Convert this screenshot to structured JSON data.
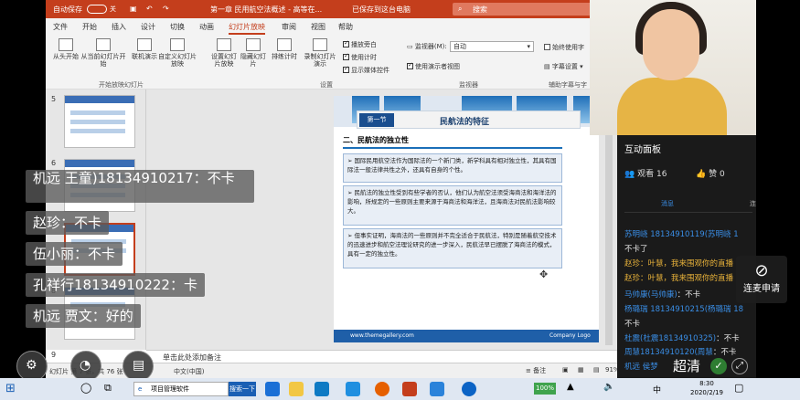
{
  "ppt": {
    "titlebar": {
      "autosave_label": "自动保存",
      "autosave_state": "关",
      "doc_title": "第一章 民用航空法概述 - 高等在...",
      "saved_status": "已保存到这台电脑",
      "search_placeholder": "搜索"
    },
    "tabs": [
      "文件",
      "开始",
      "插入",
      "设计",
      "切换",
      "动画",
      "幻灯片放映",
      "审阅",
      "视图",
      "帮助"
    ],
    "active_tab": "幻灯片放映",
    "ribbon": {
      "btn_from_start": "从头开始",
      "btn_from_current": "从当前幻灯片开始",
      "btn_online": "联机演示",
      "btn_custom": "自定义幻灯片放映",
      "group_start": "开始放映幻灯片",
      "btn_setup": "设置幻灯片放映",
      "btn_hide": "隐藏幻灯片",
      "btn_rehearse": "排练计时",
      "btn_record": "录制幻灯片演示",
      "chk_narration": "播放旁白",
      "chk_timing": "使用计时",
      "chk_media": "显示媒体控件",
      "group_setup": "设置",
      "monitor_label": "监视器(M):",
      "monitor_value": "自动",
      "chk_presenter": "使用演示者视图",
      "group_monitor": "监视器",
      "chk_subtitles": "始终使用字",
      "subtitle_setting": "字幕设置",
      "group_caption": "辅助字幕与字"
    },
    "thumbs": {
      "n5": "5",
      "n6": "6",
      "n7": "7",
      "n8": "8",
      "n9": "9"
    },
    "slide": {
      "section_label": "第一节",
      "section_title": "民航法的特征",
      "subheading": "二、民航法的独立性",
      "paragraphs": [
        "➢ 国际民用航空法作为国际法的一个新门类，新学科具有相对独立性，其具有国际法一般法律共性之外，还具有自身的个性。",
        "➢ 民航法的独立性受到有些学者的否认，他们认为航空法须受海商法和海洋法的影响，所规定的一些原则主要来源于海商法和海洋法，且海商法对民航法影响较大。",
        "➢ 但事实证明，海商法的一些原则并不完全适合于民航法，特别是随着航空技术的迅速进步和航空法理论研究的进一步深入，民航法早已摆脱了海商法的模式，具有一定的独立性。"
      ],
      "footer_url": "www.themegallery.com",
      "footer_logo": "Company Logo"
    },
    "notes_placeholder": "单击此处添加备注",
    "status": {
      "slide_pos": "幻灯片 第 7 张，共 76 张",
      "lang": "中文(中国)",
      "notes_btn": "备注",
      "zoom": "91%"
    }
  },
  "panel": {
    "title": "互动面板",
    "viewers_label": "观看",
    "viewers": "16",
    "likes_label": "赞",
    "likes": "0",
    "tab_messages": "消息",
    "tab_other": "连",
    "messages": [
      {
        "user": "苏明峣 18134910119(苏明峣 1",
        "text": ""
      },
      {
        "user": "",
        "text": "不卡了"
      },
      {
        "user": "赵珍：叶慧，我来围观你的直播",
        "text": ""
      },
      {
        "user": "赵珍：叶慧，我来围观你的直播",
        "text": ""
      },
      {
        "user": "马帅康(马帅康)",
        "text": "：不卡"
      },
      {
        "user": "杨璐瑞 18134910215(杨璐瑞 18",
        "text": ""
      },
      {
        "user": "",
        "text": "不卡"
      },
      {
        "user": "杜震(杜震18134910325)",
        "text": "：不卡"
      },
      {
        "user": "周慧18134910120(周慧",
        "text": "：不卡"
      },
      {
        "user": "机远 侯梦",
        "text": ""
      }
    ]
  },
  "overlay_chat": [
    {
      "user": "机远  王童)18134910217",
      "text": "：不卡"
    },
    {
      "user": "赵珍",
      "text": "：不卡"
    },
    {
      "user": "伍小丽",
      "text": "：不卡"
    },
    {
      "user": "孔祥行18134910222",
      "text": "：卡"
    },
    {
      "user": "机远 贾文",
      "text": "：好的"
    }
  ],
  "controls": {
    "lianmai": "连麦申请",
    "quality": "超清"
  },
  "taskbar": {
    "search_text": "项目管理软件",
    "search_btn": "搜索一下",
    "battery": "100%",
    "ime": "中",
    "time": "8:30",
    "date": "2020/2/19"
  }
}
